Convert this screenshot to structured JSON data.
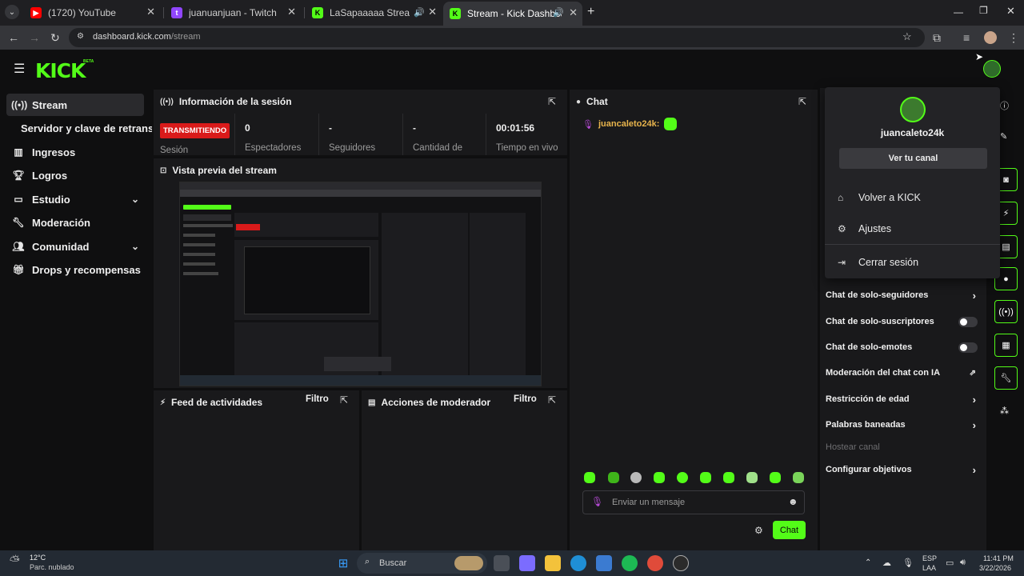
{
  "browser": {
    "tabs": [
      {
        "title": "(1720) YouTube"
      },
      {
        "title": "juanuanjuan - Twitch"
      },
      {
        "title": "LaSapaaaaa Stream - Watch"
      },
      {
        "title": "Stream - Kick Dashboard"
      }
    ],
    "url_host": "dashboard.kick.com",
    "url_path": "/stream"
  },
  "brand": {
    "logo": "KICK",
    "badge": "BETA",
    "accent": "#53fc18"
  },
  "sidebar": {
    "items": [
      {
        "label": "Stream",
        "icon": "broadcast-icon"
      },
      {
        "label": "Ingresos",
        "icon": "bar-chart-icon"
      },
      {
        "label": "Logros",
        "icon": "trophy-icon"
      },
      {
        "label": "Estudio",
        "icon": "monitor-icon"
      },
      {
        "label": "Moderación",
        "icon": "wrench-icon"
      },
      {
        "label": "Comunidad",
        "icon": "people-icon"
      },
      {
        "label": "Drops y recompensas",
        "icon": "gift-icon"
      }
    ],
    "sub_item": "Servidor y clave de retransmisión"
  },
  "session": {
    "title": "Información de la sesión",
    "badge": "TRANSMITIENDO",
    "session_label": "Sesión",
    "stats": [
      {
        "value": "0",
        "label": "Espectadores"
      },
      {
        "value": "-",
        "label": "Seguidores"
      },
      {
        "value": "-",
        "label": "Cantidad de"
      },
      {
        "value": "00:01:56",
        "label": "Tiempo en vivo"
      }
    ]
  },
  "preview": {
    "title": "Vista previa del stream"
  },
  "activity": {
    "title": "Feed de actividades",
    "filter": "Filtro"
  },
  "modactions": {
    "title": "Acciones de moderador",
    "filter": "Filtro"
  },
  "chat": {
    "title": "Chat",
    "messages": [
      {
        "user": "juancaleto24k:"
      }
    ],
    "placeholder": "Enviar un mensaje",
    "send": "Chat"
  },
  "channel_options": {
    "items": [
      {
        "label": "Chat de solo-seguidores",
        "control": "chevron"
      },
      {
        "label": "Chat de solo-suscriptores",
        "control": "toggle"
      },
      {
        "label": "Chat de solo-emotes",
        "control": "toggle"
      },
      {
        "label": "Moderación del chat con IA",
        "control": "external"
      },
      {
        "label": "Restricción de edad",
        "control": "chevron"
      },
      {
        "label": "Palabras baneadas",
        "control": "chevron"
      },
      {
        "label": "Hostear canal",
        "control": "disabled"
      },
      {
        "label": "Configurar objetivos",
        "control": "chevron"
      }
    ]
  },
  "user_menu": {
    "username": "juancaleto24k",
    "view_channel": "Ver tu canal",
    "items": [
      {
        "label": "Volver a KICK",
        "icon": "home-icon"
      },
      {
        "label": "Ajustes",
        "icon": "gear-icon"
      },
      {
        "label": "Cerrar sesión",
        "icon": "logout-icon"
      }
    ]
  },
  "taskbar": {
    "weather_temp": "12°C",
    "weather_desc": "Parc. nublado",
    "search": "Buscar",
    "lang_line1": "ESP",
    "lang_line2": "LAA",
    "time": "11:41 PM",
    "date": "3/22/2026"
  }
}
